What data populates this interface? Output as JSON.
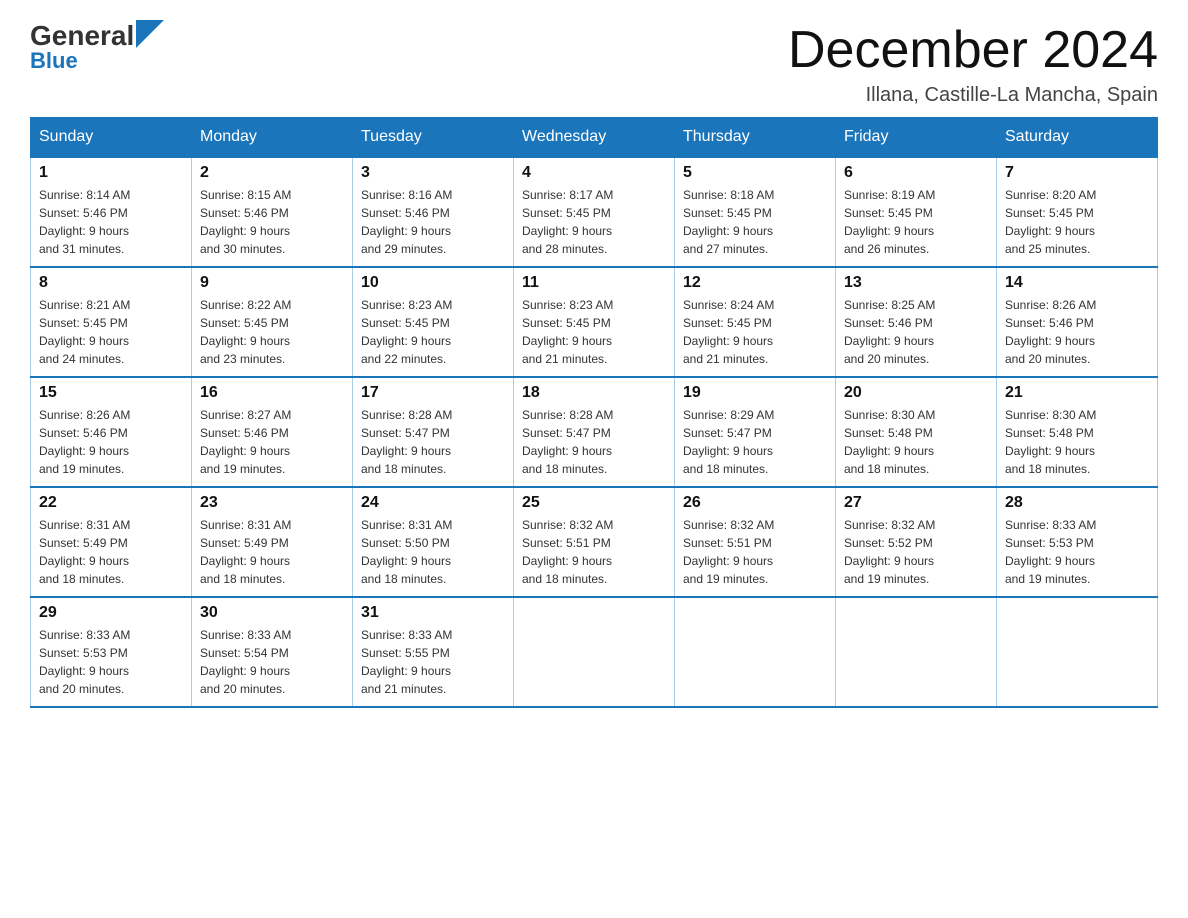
{
  "header": {
    "logo_main": "General",
    "logo_sub": "Blue",
    "month_title": "December 2024",
    "location": "Illana, Castille-La Mancha, Spain"
  },
  "days_of_week": [
    "Sunday",
    "Monday",
    "Tuesday",
    "Wednesday",
    "Thursday",
    "Friday",
    "Saturday"
  ],
  "weeks": [
    [
      {
        "day": "1",
        "sunrise": "8:14 AM",
        "sunset": "5:46 PM",
        "daylight": "9 hours and 31 minutes."
      },
      {
        "day": "2",
        "sunrise": "8:15 AM",
        "sunset": "5:46 PM",
        "daylight": "9 hours and 30 minutes."
      },
      {
        "day": "3",
        "sunrise": "8:16 AM",
        "sunset": "5:46 PM",
        "daylight": "9 hours and 29 minutes."
      },
      {
        "day": "4",
        "sunrise": "8:17 AM",
        "sunset": "5:45 PM",
        "daylight": "9 hours and 28 minutes."
      },
      {
        "day": "5",
        "sunrise": "8:18 AM",
        "sunset": "5:45 PM",
        "daylight": "9 hours and 27 minutes."
      },
      {
        "day": "6",
        "sunrise": "8:19 AM",
        "sunset": "5:45 PM",
        "daylight": "9 hours and 26 minutes."
      },
      {
        "day": "7",
        "sunrise": "8:20 AM",
        "sunset": "5:45 PM",
        "daylight": "9 hours and 25 minutes."
      }
    ],
    [
      {
        "day": "8",
        "sunrise": "8:21 AM",
        "sunset": "5:45 PM",
        "daylight": "9 hours and 24 minutes."
      },
      {
        "day": "9",
        "sunrise": "8:22 AM",
        "sunset": "5:45 PM",
        "daylight": "9 hours and 23 minutes."
      },
      {
        "day": "10",
        "sunrise": "8:23 AM",
        "sunset": "5:45 PM",
        "daylight": "9 hours and 22 minutes."
      },
      {
        "day": "11",
        "sunrise": "8:23 AM",
        "sunset": "5:45 PM",
        "daylight": "9 hours and 21 minutes."
      },
      {
        "day": "12",
        "sunrise": "8:24 AM",
        "sunset": "5:45 PM",
        "daylight": "9 hours and 21 minutes."
      },
      {
        "day": "13",
        "sunrise": "8:25 AM",
        "sunset": "5:46 PM",
        "daylight": "9 hours and 20 minutes."
      },
      {
        "day": "14",
        "sunrise": "8:26 AM",
        "sunset": "5:46 PM",
        "daylight": "9 hours and 20 minutes."
      }
    ],
    [
      {
        "day": "15",
        "sunrise": "8:26 AM",
        "sunset": "5:46 PM",
        "daylight": "9 hours and 19 minutes."
      },
      {
        "day": "16",
        "sunrise": "8:27 AM",
        "sunset": "5:46 PM",
        "daylight": "9 hours and 19 minutes."
      },
      {
        "day": "17",
        "sunrise": "8:28 AM",
        "sunset": "5:47 PM",
        "daylight": "9 hours and 18 minutes."
      },
      {
        "day": "18",
        "sunrise": "8:28 AM",
        "sunset": "5:47 PM",
        "daylight": "9 hours and 18 minutes."
      },
      {
        "day": "19",
        "sunrise": "8:29 AM",
        "sunset": "5:47 PM",
        "daylight": "9 hours and 18 minutes."
      },
      {
        "day": "20",
        "sunrise": "8:30 AM",
        "sunset": "5:48 PM",
        "daylight": "9 hours and 18 minutes."
      },
      {
        "day": "21",
        "sunrise": "8:30 AM",
        "sunset": "5:48 PM",
        "daylight": "9 hours and 18 minutes."
      }
    ],
    [
      {
        "day": "22",
        "sunrise": "8:31 AM",
        "sunset": "5:49 PM",
        "daylight": "9 hours and 18 minutes."
      },
      {
        "day": "23",
        "sunrise": "8:31 AM",
        "sunset": "5:49 PM",
        "daylight": "9 hours and 18 minutes."
      },
      {
        "day": "24",
        "sunrise": "8:31 AM",
        "sunset": "5:50 PM",
        "daylight": "9 hours and 18 minutes."
      },
      {
        "day": "25",
        "sunrise": "8:32 AM",
        "sunset": "5:51 PM",
        "daylight": "9 hours and 18 minutes."
      },
      {
        "day": "26",
        "sunrise": "8:32 AM",
        "sunset": "5:51 PM",
        "daylight": "9 hours and 19 minutes."
      },
      {
        "day": "27",
        "sunrise": "8:32 AM",
        "sunset": "5:52 PM",
        "daylight": "9 hours and 19 minutes."
      },
      {
        "day": "28",
        "sunrise": "8:33 AM",
        "sunset": "5:53 PM",
        "daylight": "9 hours and 19 minutes."
      }
    ],
    [
      {
        "day": "29",
        "sunrise": "8:33 AM",
        "sunset": "5:53 PM",
        "daylight": "9 hours and 20 minutes."
      },
      {
        "day": "30",
        "sunrise": "8:33 AM",
        "sunset": "5:54 PM",
        "daylight": "9 hours and 20 minutes."
      },
      {
        "day": "31",
        "sunrise": "8:33 AM",
        "sunset": "5:55 PM",
        "daylight": "9 hours and 21 minutes."
      },
      null,
      null,
      null,
      null
    ]
  ],
  "labels": {
    "sunrise": "Sunrise:",
    "sunset": "Sunset:",
    "daylight": "Daylight:"
  }
}
